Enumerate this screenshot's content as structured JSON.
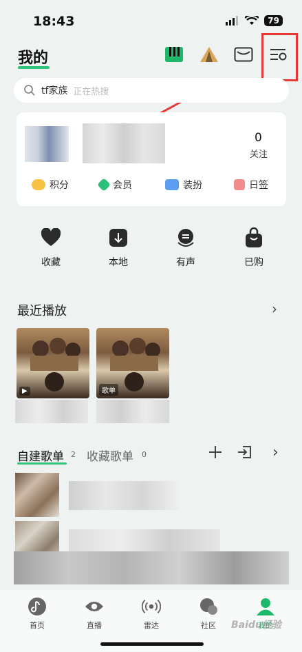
{
  "status_bar": {
    "time": "18:43",
    "battery": "79"
  },
  "header": {
    "title": "我的"
  },
  "search": {
    "query": "tf家族",
    "hint": "正在热搜"
  },
  "profile": {
    "follow_count": "0",
    "follow_label": "关注"
  },
  "quick_links": [
    {
      "label": "积分",
      "icon": "coin-icon",
      "color": "#f5c242"
    },
    {
      "label": "会员",
      "icon": "diamond-icon",
      "color": "#2bc07a"
    },
    {
      "label": "装扮",
      "icon": "shirt-icon",
      "color": "#5b9ef0"
    },
    {
      "label": "日签",
      "icon": "calendar-icon",
      "color": "#f08c8c"
    }
  ],
  "functions": [
    {
      "label": "收藏",
      "icon": "heart-icon"
    },
    {
      "label": "本地",
      "icon": "download-icon"
    },
    {
      "label": "有声",
      "icon": "audiobook-icon"
    },
    {
      "label": "已购",
      "icon": "bag-icon"
    }
  ],
  "recent": {
    "title": "最近播放",
    "items": [
      {
        "tag": "▶"
      },
      {
        "tag": "歌单"
      }
    ]
  },
  "playlists": {
    "tabs": [
      {
        "label": "自建歌单",
        "count": "2"
      },
      {
        "label": "收藏歌单",
        "count": "0"
      }
    ]
  },
  "bottom_nav": [
    {
      "label": "首页",
      "icon": "music-note-icon"
    },
    {
      "label": "直播",
      "icon": "eye-icon"
    },
    {
      "label": "雷达",
      "icon": "radar-icon"
    },
    {
      "label": "社区",
      "icon": "community-icon"
    },
    {
      "label": "我的",
      "icon": "person-icon",
      "active": true
    }
  ],
  "watermark": "Baidu经验",
  "colors": {
    "accent": "#31c27c",
    "highlight_box": "#e53935"
  }
}
